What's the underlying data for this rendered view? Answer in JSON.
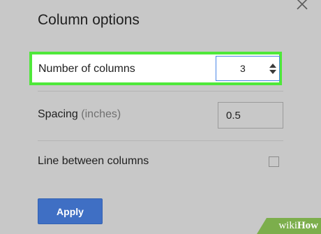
{
  "dialog": {
    "title": "Column options",
    "close_icon": "close-icon"
  },
  "columns": {
    "label": "Number of columns",
    "value": "3"
  },
  "spacing": {
    "label": "Spacing",
    "unit": "(inches)",
    "value": "0.5"
  },
  "line_between": {
    "label": "Line between columns",
    "checked": false
  },
  "apply_label": "Apply",
  "watermark": {
    "prefix": "wiki",
    "suffix": "How"
  },
  "colors": {
    "highlight": "#4fe83a",
    "apply_button": "#3f6fc4",
    "watermark": "#7cae4c"
  }
}
